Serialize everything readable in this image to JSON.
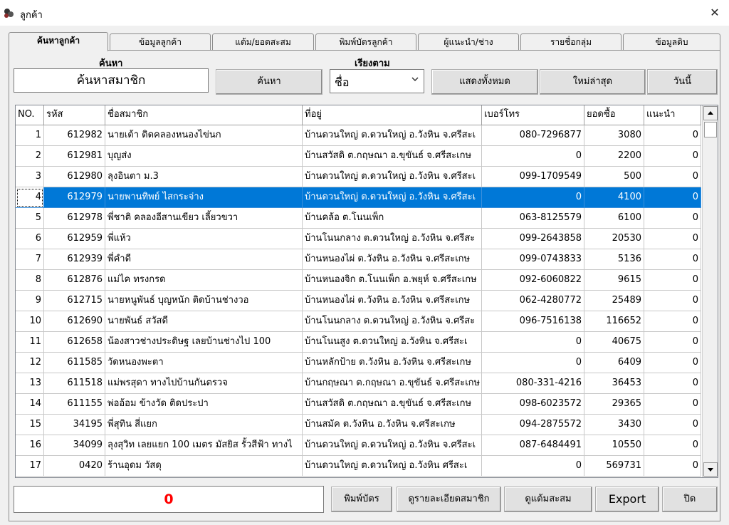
{
  "window": {
    "title": "ลูกค้า",
    "close_glyph": "✕"
  },
  "tabs": [
    {
      "label": "ค้นหาลูกค้า",
      "active": true
    },
    {
      "label": "ข้อมูลลูกค้า"
    },
    {
      "label": "แต้ม/ยอดสะสม"
    },
    {
      "label": "พิมพ์บัตรลูกค้า"
    },
    {
      "label": "ผู้แนะนำ/ช่าง"
    },
    {
      "label": "รายชื่อกลุ่ม"
    },
    {
      "label": "ข้อมูลดิบ"
    }
  ],
  "search": {
    "label": "ค้นหา",
    "value": "ค้นหาสมาชิก",
    "button_label": "ค้นหา"
  },
  "sort": {
    "label": "เรียงตาม",
    "selected": "ชื่อ"
  },
  "filter_buttons": {
    "show_all": "แสดงทั้งหมด",
    "newest": "ใหม่ล่าสุด",
    "today": "วันนี้"
  },
  "grid": {
    "columns": [
      "NO.",
      "รหัส",
      "ชื่อสมาชิก",
      "ที่อยู่",
      "เบอร์โทร",
      "ยอดซื้อ",
      "แนะนำ"
    ],
    "selected_row": 3,
    "rows": [
      [
        "1",
        "612982",
        "นายเต้า ติดคลองหนองไข่นก",
        "บ้านดวนใหญ่ ต.ดวนใหญ่ อ.วังหิน จ.ศรีสะเ",
        "080-7296877",
        "3080",
        "0"
      ],
      [
        "2",
        "612981",
        "บุญส่ง",
        "บ้านสวัสดิ ต.กฤษณา อ.ขุขันธ์ จ.ศรีสะเกษ",
        "0",
        "2200",
        "0"
      ],
      [
        "3",
        "612980",
        "ลุงอินตา ม.3",
        "บ้านดวนใหญ่ ต.ดวนใหญ่ อ.วังหิน จ.ศรีสะเ",
        "099-1709549",
        "500",
        "0"
      ],
      [
        "4",
        "612979",
        "นายพานทิพย์ ไสกระจ่าง",
        "บ้านดวนใหญ่ ต.ดวนใหญ่ อ.วังหิน จ.ศรีสะเ",
        "0",
        "4100",
        "0"
      ],
      [
        "5",
        "612978",
        "พี่ชาติ คลองอีสานเขียว เลี้ยวขวา",
        "บ้านคล้อ ต.โนนเพ็ก",
        "063-8125579",
        "6100",
        "0"
      ],
      [
        "6",
        "612959",
        "พี่แห้ว",
        "บ้านโนนกลาง ต.ดวนใหญ่ อ.วังหิน จ.ศรีสะ",
        "099-2643858",
        "20530",
        "0"
      ],
      [
        "7",
        "612939",
        "พี่คำดี",
        "บ้านหนองไผ่ ต.วังหิน อ.วังหิน จ.ศรีสะเกษ",
        "099-0743833",
        "5136",
        "0"
      ],
      [
        "8",
        "612876",
        "แม่ไค ทรงกรด",
        "บ้านหนองจิก ต.โนนเพ็ก อ.พยุห์ จ.ศรีสะเกษ",
        "092-6060822",
        "9615",
        "0"
      ],
      [
        "9",
        "612715",
        "นายหนูพันธ์ บุญหนัก ติดบ้านช่างวอ",
        "บ้านหนองไผ่ ต.วังหิน อ.วังหิน จ.ศรีสะเกษ",
        "062-4280772",
        "25489",
        "0"
      ],
      [
        "10",
        "612690",
        "นายพันธ์ สวัสดี",
        "บ้านโนนกลาง ต.ดวนใหญ่ อ.วังหิน จ.ศรีสะ",
        "096-7516138",
        "116652",
        "0"
      ],
      [
        "11",
        "612658",
        "น้องสาวช่างประดิษฐ เลยบ้านช่างไป 100",
        "บ้านโนนสูง ต.ดวนใหญ่ อ.วังหิน จ.ศรีสะเ",
        "0",
        "40675",
        "0"
      ],
      [
        "12",
        "611585",
        "วัดหนองพะตา",
        "บ้านหลักป้าย ต.วังหิน อ.วังหิน จ.ศรีสะเกษ",
        "0",
        "6409",
        "0"
      ],
      [
        "13",
        "611518",
        "แม่พรสุดา ทางไปบ้านกันตรวจ",
        "บ้านกฤษณา ต.กฤษณา อ.ขุขันธ์ จ.ศรีสะเกษ",
        "080-331-4216",
        "36453",
        "0"
      ],
      [
        "14",
        "611155",
        "พ่ออ้อม ข้างวัด ติดประปา",
        "บ้านสวัสดิ ต.กฤษณา อ.ขุขันธ์ จ.ศรีสะเกษ",
        "098-6023572",
        "29365",
        "0"
      ],
      [
        "15",
        "34195",
        "พี่สุทิน สี่แยก",
        "บ้านสมัค ต.วังหิน อ.วังหิน จ.ศรีสะเกษ",
        "094-2875572",
        "3430",
        "0"
      ],
      [
        "16",
        "34099",
        "ลุงสุวิท เลยแยก 100 เมตร มัสยิส รั้วสีฟ้า ทางไ",
        "บ้านดวนใหญ่ ต.ดวนใหญ่ อ.วังหิน จ.ศรีสะเ",
        "087-6484491",
        "10550",
        "0"
      ],
      [
        "17",
        "0420",
        "ร้านอุดม วัสดุ",
        "บ้านดวนใหญ่ ต.ดวนใหญ่ อ.วังหิน ศรีสะเ",
        "0",
        "569731",
        "0"
      ]
    ]
  },
  "footer": {
    "counter": "0",
    "print_card": "พิมพ์บัตร",
    "view_details": "ดูรายละเอียดสมาชิก",
    "view_points": "ดูแต้มสะสม",
    "export": "Export",
    "close": "ปิด"
  }
}
